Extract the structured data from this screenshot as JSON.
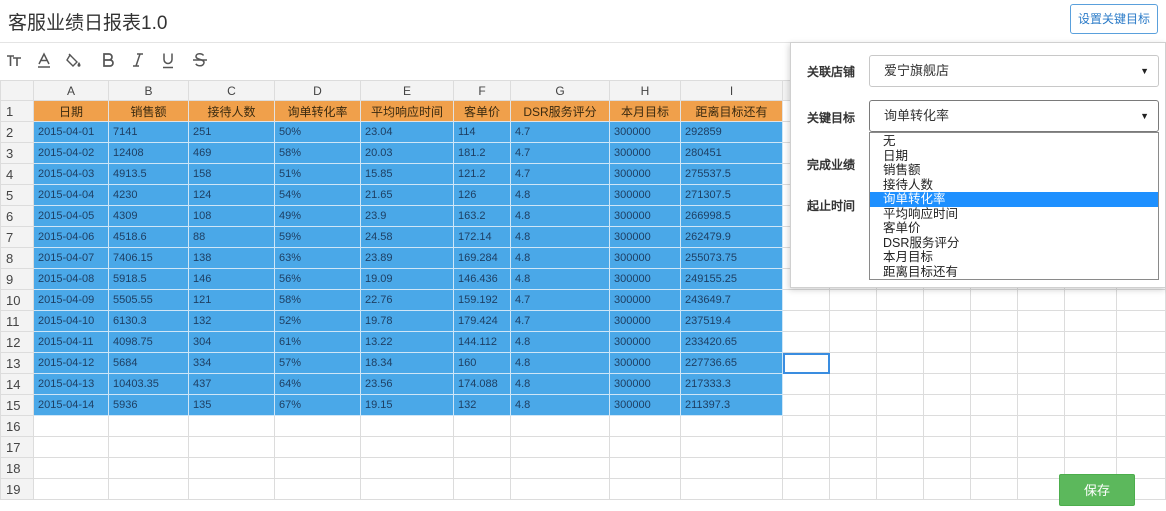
{
  "page": {
    "title": "客服业绩日报表1.0",
    "set_target_label": "设置关键目标",
    "save_label": "保存"
  },
  "toolbar": {
    "items": [
      {
        "name": "text-size-icon",
        "glyph": "ₜT"
      },
      {
        "name": "font-color-icon",
        "glyph": "A"
      },
      {
        "name": "fill-color-icon",
        "glyph": "bucket"
      },
      {
        "name": "bold-icon",
        "glyph": "B"
      },
      {
        "name": "italic-icon",
        "glyph": "I"
      },
      {
        "name": "underline-icon",
        "glyph": "U"
      },
      {
        "name": "strikethrough-icon",
        "glyph": "S"
      }
    ]
  },
  "sheet": {
    "columns": [
      "A",
      "B",
      "C",
      "D",
      "E",
      "F",
      "G",
      "H",
      "I",
      "",
      "",
      "",
      "",
      "",
      "",
      "",
      ""
    ],
    "headers": [
      "日期",
      "销售额",
      "接待人数",
      "询单转化率",
      "平均响应时间",
      "客单价",
      "DSR服务评分",
      "本月目标",
      "距离目标还有"
    ],
    "rows": [
      [
        "2015-04-01",
        "7141",
        "251",
        "50%",
        "23.04",
        "114",
        "4.7",
        "300000",
        "292859"
      ],
      [
        "2015-04-02",
        "12408",
        "469",
        "58%",
        "20.03",
        "181.2",
        "4.7",
        "300000",
        "280451"
      ],
      [
        "2015-04-03",
        "4913.5",
        "158",
        "51%",
        "15.85",
        "121.2",
        "4.7",
        "300000",
        "275537.5"
      ],
      [
        "2015-04-04",
        "4230",
        "124",
        "54%",
        "21.65",
        "126",
        "4.8",
        "300000",
        "271307.5"
      ],
      [
        "2015-04-05",
        "4309",
        "108",
        "49%",
        "23.9",
        "163.2",
        "4.8",
        "300000",
        "266998.5"
      ],
      [
        "2015-04-06",
        "4518.6",
        "88",
        "59%",
        "24.58",
        "172.14",
        "4.8",
        "300000",
        "262479.9"
      ],
      [
        "2015-04-07",
        "7406.15",
        "138",
        "63%",
        "23.89",
        "169.284",
        "4.8",
        "300000",
        "255073.75"
      ],
      [
        "2015-04-08",
        "5918.5",
        "146",
        "56%",
        "19.09",
        "146.436",
        "4.8",
        "300000",
        "249155.25"
      ],
      [
        "2015-04-09",
        "5505.55",
        "121",
        "58%",
        "22.76",
        "159.192",
        "4.7",
        "300000",
        "243649.7"
      ],
      [
        "2015-04-10",
        "6130.3",
        "132",
        "52%",
        "19.78",
        "179.424",
        "4.7",
        "300000",
        "237519.4"
      ],
      [
        "2015-04-11",
        "4098.75",
        "304",
        "61%",
        "13.22",
        "144.112",
        "4.8",
        "300000",
        "233420.65"
      ],
      [
        "2015-04-12",
        "5684",
        "334",
        "57%",
        "18.34",
        "160",
        "4.8",
        "300000",
        "227736.65"
      ],
      [
        "2015-04-13",
        "10403.35",
        "437",
        "64%",
        "23.56",
        "174.088",
        "4.8",
        "300000",
        "217333.3"
      ],
      [
        "2015-04-14",
        "5936",
        "135",
        "67%",
        "19.15",
        "132",
        "4.8",
        "300000",
        "211397.3"
      ]
    ],
    "row_numbers": [
      "1",
      "2",
      "3",
      "4",
      "5",
      "6",
      "7",
      "8",
      "9",
      "10",
      "11",
      "12",
      "13",
      "14",
      "15",
      "16",
      "17",
      "18",
      "19"
    ],
    "header_color": "#f0a04b",
    "data_color": "#4aa8e8",
    "selected_cell": "J13"
  },
  "panel": {
    "store_label": "关联店铺",
    "store_value": "爱宁旗舰店",
    "target_label": "关键目标",
    "target_value": "询单转化率",
    "done_label": "完成业绩",
    "period_label": "起止时间",
    "options": [
      "无",
      "日期",
      "销售额",
      "接待人数",
      "询单转化率",
      "平均响应时间",
      "客单价",
      "DSR服务评分",
      "本月目标",
      "距离目标还有"
    ],
    "active_option": "询单转化率"
  },
  "colors": {
    "accent": "#2b7bc8",
    "save_green": "#5cb85c",
    "dropdown_highlight": "#1e90ff"
  }
}
